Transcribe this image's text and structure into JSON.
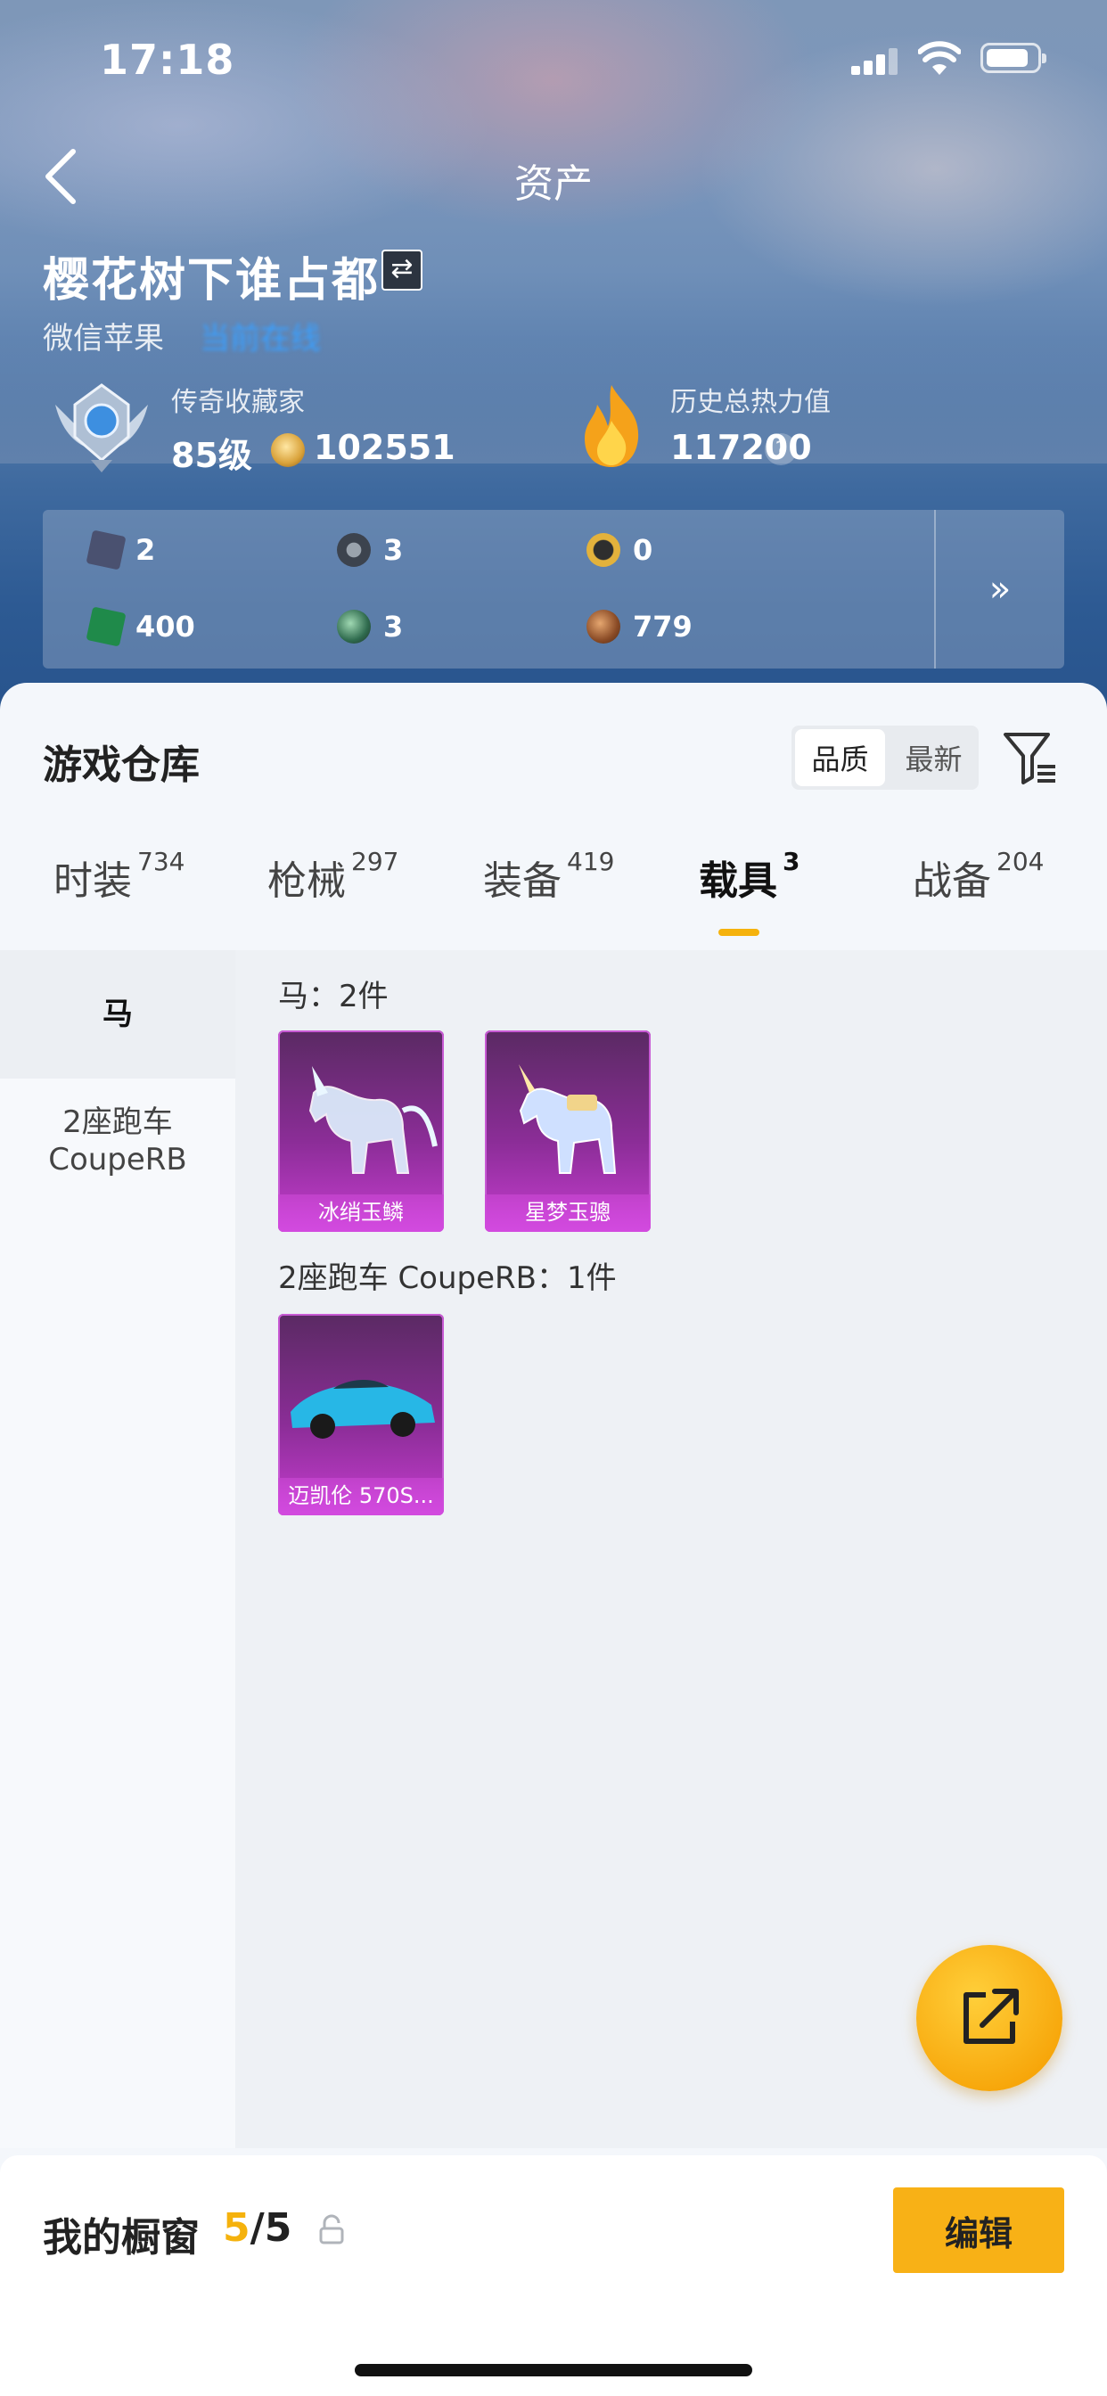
{
  "status_bar": {
    "time": "17:18"
  },
  "nav": {
    "title": "资产"
  },
  "profile": {
    "username": "樱花树下谁占都",
    "platform": "微信苹果",
    "online_status": "当前在线",
    "rank_title": "传奇收藏家",
    "rank_level": "85级",
    "collection_points": "102551",
    "heat_title": "历史总热力值",
    "heat_value": "117200",
    "help_label": "?"
  },
  "currencies": [
    {
      "icon": "card-icon",
      "value": "2",
      "color": "#4a5170"
    },
    {
      "icon": "dial-coin-icon",
      "value": "3",
      "color": "#3c434e"
    },
    {
      "icon": "gold-medal-icon",
      "value": "0",
      "color": "#2e2e2e"
    },
    {
      "icon": "green-ticket-icon",
      "value": "400",
      "color": "#1f8a4a"
    },
    {
      "icon": "green-orb-icon",
      "value": "3",
      "color": "#2f6b4e"
    },
    {
      "icon": "bronze-coin-icon",
      "value": "779",
      "color": "#8a4b26"
    }
  ],
  "currency_more_label": "»",
  "warehouse": {
    "title": "游戏仓库",
    "sort_options": [
      "品质",
      "最新"
    ],
    "tabs": [
      {
        "label": "时装",
        "count": "734"
      },
      {
        "label": "枪械",
        "count": "297"
      },
      {
        "label": "装备",
        "count": "419"
      },
      {
        "label": "载具",
        "count": "3"
      },
      {
        "label": "战备",
        "count": "204"
      }
    ],
    "sidebar": [
      "马",
      "2座跑车 CoupeRB"
    ],
    "groups": [
      {
        "title": "马：2件",
        "items": [
          "冰绡玉鳞",
          "星梦玉骢"
        ]
      },
      {
        "title": "2座跑车 CoupeRB：1件",
        "items": [
          "迈凯伦 570S..."
        ]
      }
    ]
  },
  "showcase": {
    "label": "我的橱窗",
    "current": "5",
    "total": "/5",
    "edit_label": "编辑"
  }
}
